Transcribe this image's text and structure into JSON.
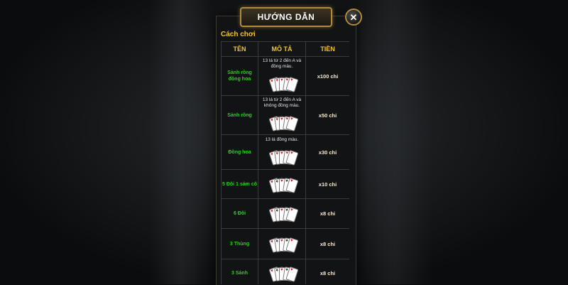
{
  "dialog": {
    "title": "HƯỚNG DẪN",
    "close_label": "✕",
    "subtitle": "Cách chơi"
  },
  "table": {
    "headers": [
      "TÊN",
      "MÔ TẢ",
      "TIỀN"
    ],
    "rows": [
      {
        "name": "Sảnh rồng đồng hoa",
        "description": "13 lá từ 2 đến A và đồng màu.",
        "reward": "x100 chi"
      },
      {
        "name": "Sảnh rồng",
        "description": "13 lá từ 2 đến A và không đồng màu.",
        "reward": "x50 chi"
      },
      {
        "name": "Đồng hoa",
        "description": "13 lá đồng màu.",
        "reward": "x30 chi"
      },
      {
        "name": "5 Đôi 1 sám cô",
        "description": "",
        "reward": "x10 chi"
      },
      {
        "name": "6 Đôi",
        "description": "",
        "reward": "x8 chi"
      },
      {
        "name": "3 Thùng",
        "description": "",
        "reward": "x8 chi"
      },
      {
        "name": "3 Sảnh",
        "description": "",
        "reward": "x8 chi"
      }
    ]
  },
  "colors": {
    "gold_accent": "#f2c230",
    "green_name": "#27d21a",
    "panel_bg": "#121314",
    "border": "#b08a3e"
  },
  "icons": {
    "close": "close-icon",
    "cards": "playing-cards-icon"
  }
}
